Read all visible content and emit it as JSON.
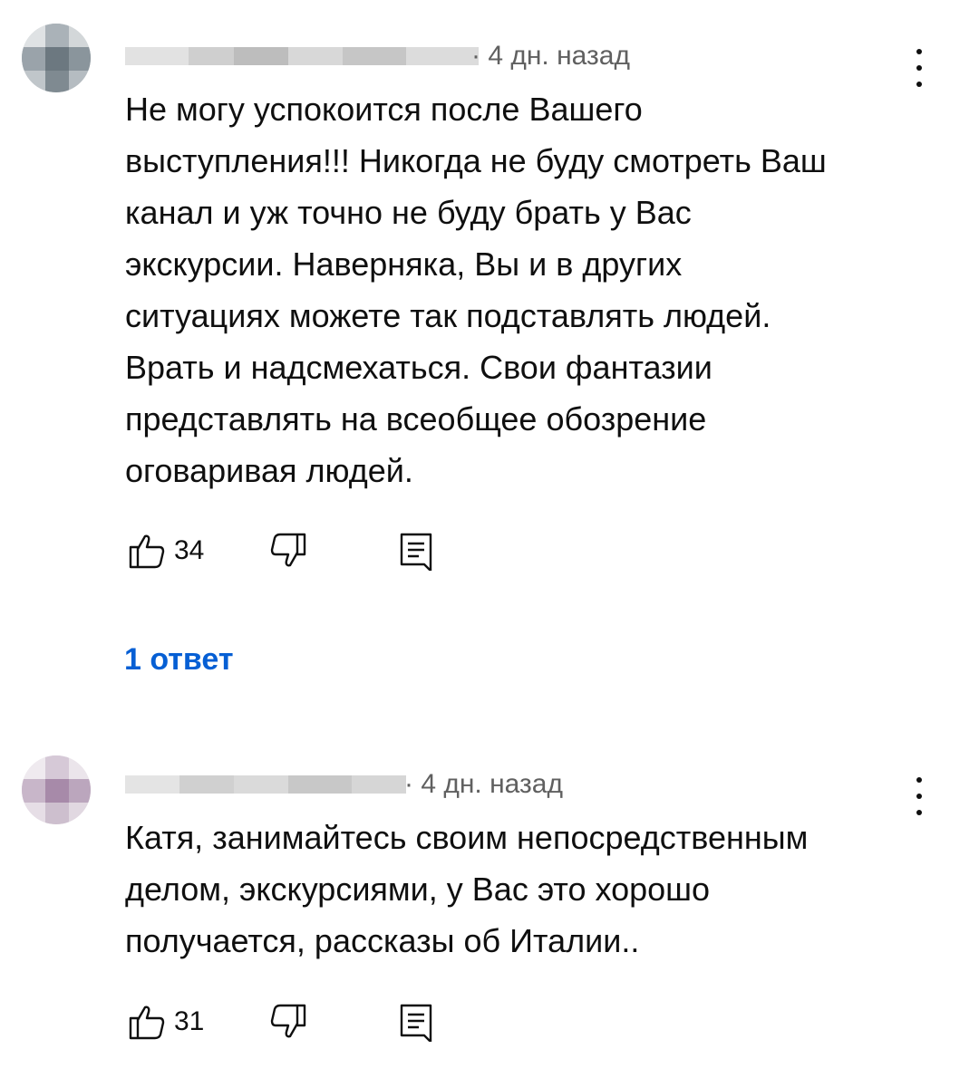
{
  "comments": [
    {
      "time": "· 4 дн. назад",
      "text": "Не могу успокоится после Вашего\nвыступления!!! Никогда не буду смотреть Ваш\nканал и уж точно не буду брать у Вас\nэкскурсии. Наверняка, Вы и в других\nситуациях можете так подставлять людей.\nВрать и надсмехаться. Свои фантазии\nпредставлять на всеобщее обозрение\nоговаривая людей.",
      "likes": "34",
      "replies": "1 ответ",
      "avatar_color": "#7d8a93"
    },
    {
      "time": "· 4 дн. назад",
      "text": "Катя, занимайтесь своим непосредственным\nделом, экскурсиями, у Вас это хорошо\nполучается, рассказы об Италии..",
      "likes": "31",
      "avatar_color": "#b29bb4"
    }
  ],
  "icons": {
    "like": "thumb-up-outline",
    "dislike": "thumb-down-outline",
    "reply": "comment-outline",
    "menu": "more-vertical"
  },
  "colors": {
    "link": "#065fd4",
    "meta": "#606060",
    "text": "#0f0f0f"
  }
}
